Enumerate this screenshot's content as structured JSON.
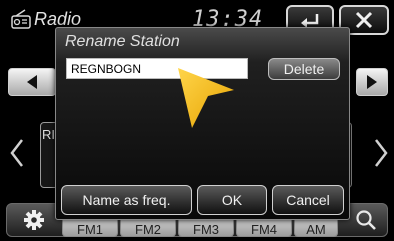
{
  "header": {
    "app_title": "Radio",
    "clock": "13:34",
    "back_icon": "back-arrow-icon",
    "close_icon": "close-icon"
  },
  "station_fragment": "RI",
  "bottom_bar": {
    "tabs": [
      "FM1",
      "FM2",
      "FM3",
      "FM4",
      "AM"
    ],
    "settings_icon": "gear-icon",
    "search_icon": "search-icon"
  },
  "dialog": {
    "title": "Rename Station",
    "input_value": "REGNBOGN",
    "delete_label": "Delete",
    "name_as_freq_label": "Name as freq.",
    "ok_label": "OK",
    "cancel_label": "Cancel"
  },
  "colors": {
    "cursor": "#f5b800",
    "background": "#000000"
  }
}
